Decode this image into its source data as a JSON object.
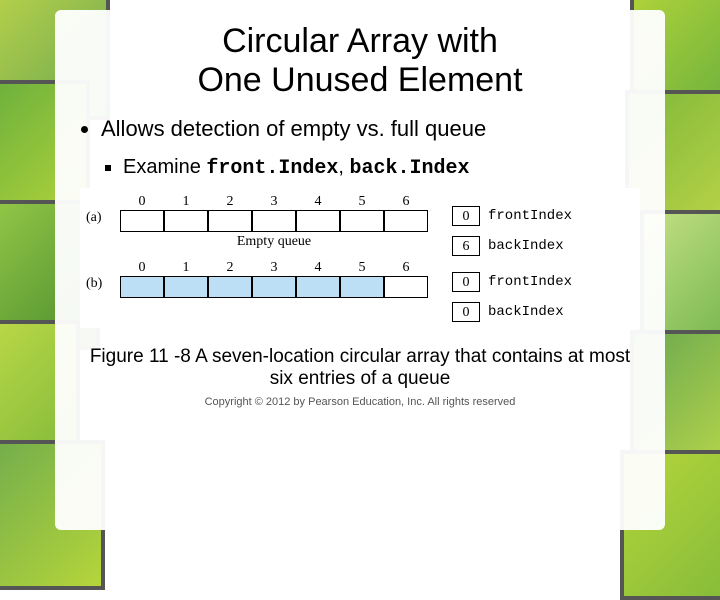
{
  "title_line1": "Circular Array with",
  "title_line2": "One Unused Element",
  "bullet_main": "Allows detection of empty vs. full queue",
  "sub_prefix": "Examine ",
  "code1": "front.Index",
  "sub_sep": ", ",
  "code2": "back.Index",
  "diagram": {
    "indices": [
      "0",
      "1",
      "2",
      "3",
      "4",
      "5",
      "6"
    ],
    "a": {
      "label": "(a)",
      "filled": [
        false,
        false,
        false,
        false,
        false,
        false,
        false
      ],
      "caption": "Empty queue",
      "front": "0",
      "back": "6",
      "front_label": "frontIndex",
      "back_label": "backIndex"
    },
    "b": {
      "label": "(b)",
      "filled": [
        true,
        true,
        true,
        true,
        true,
        true,
        false
      ],
      "front": "0",
      "back": "0",
      "front_label": "frontIndex",
      "back_label": "backIndex"
    }
  },
  "figure_caption": "Figure 11 -8 A seven-location circular array that contains at most six entries of a queue",
  "copyright": "Copyright © 2012 by Pearson Education, Inc. All rights reserved"
}
